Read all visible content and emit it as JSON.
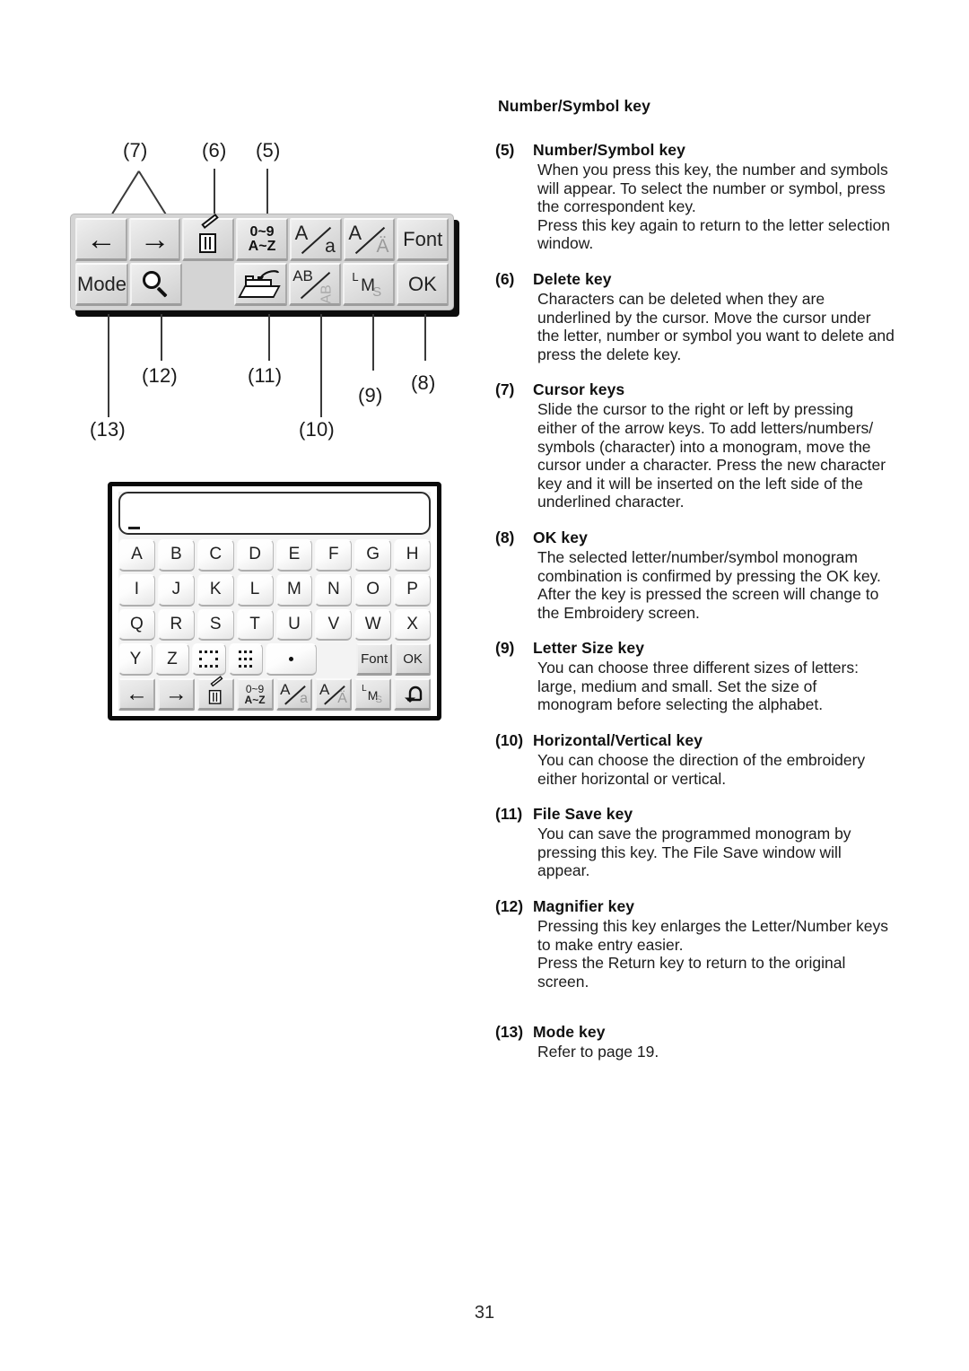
{
  "page": {
    "number": "31"
  },
  "illustration_toolbar": {
    "callouts": [
      {
        "id": "7",
        "label": "(7)"
      },
      {
        "id": "6",
        "label": "(6)"
      },
      {
        "id": "5",
        "label": "(5)"
      },
      {
        "id": "12",
        "label": "(12)"
      },
      {
        "id": "11",
        "label": "(11)"
      },
      {
        "id": "9",
        "label": "(9)"
      },
      {
        "id": "8",
        "label": "(8)"
      },
      {
        "id": "13",
        "label": "(13)"
      },
      {
        "id": "10",
        "label": "(10)"
      }
    ],
    "row1": [
      {
        "name": "cursor-left-key",
        "icon": "arrow-left-icon",
        "label": "←"
      },
      {
        "name": "cursor-right-key",
        "icon": "arrow-right-icon",
        "label": "→"
      },
      {
        "name": "delete-key",
        "icon": "trash-icon",
        "label": ""
      },
      {
        "name": "number-symbol-key",
        "icon": "number-symbol-icon",
        "label_top": "0~9",
        "label_bottom": "A~Z"
      },
      {
        "name": "case-key",
        "icon": "upper-lower-case-icon",
        "big": "A",
        "small": "a"
      },
      {
        "name": "accent-key",
        "icon": "accent-letter-icon",
        "big": "A",
        "small": "Ä"
      },
      {
        "name": "font-key",
        "icon": "font-icon",
        "label": "Font"
      }
    ],
    "row2": [
      {
        "name": "mode-key",
        "icon": "mode-icon",
        "label": "Mode"
      },
      {
        "name": "magnifier-key",
        "icon": "magnifier-icon",
        "label": ""
      },
      {
        "name": "blank-key",
        "icon": "",
        "label": ""
      },
      {
        "name": "file-save-key",
        "icon": "file-save-icon",
        "label": ""
      },
      {
        "name": "horizontal-vertical-key",
        "icon": "ab-orientation-icon",
        "big": "AB",
        "small": "AB"
      },
      {
        "name": "letter-size-key",
        "icon": "letter-size-icon",
        "l": "L",
        "m": "M",
        "s": "S"
      },
      {
        "name": "ok-key",
        "icon": "ok-icon",
        "label": "OK"
      }
    ]
  },
  "illustration_keyboard": {
    "display_value": "",
    "cursor": "_",
    "rows": [
      [
        "A",
        "B",
        "C",
        "D",
        "E",
        "F",
        "G",
        "H"
      ],
      [
        "I",
        "J",
        "K",
        "L",
        "M",
        "N",
        "O",
        "P"
      ],
      [
        "Q",
        "R",
        "S",
        "T",
        "U",
        "V",
        "W",
        "X"
      ]
    ],
    "row4": {
      "letters": [
        "Y",
        "Z"
      ],
      "space_wide": "space-wide-key",
      "space_narrow": "space-narrow-key",
      "period": ".",
      "font": "Font",
      "ok": "OK"
    },
    "row5": [
      {
        "name": "cursor-left-key",
        "icon": "arrow-left-icon",
        "label": "←"
      },
      {
        "name": "cursor-right-key",
        "icon": "arrow-right-icon",
        "label": "→"
      },
      {
        "name": "delete-key",
        "icon": "trash-icon",
        "label": ""
      },
      {
        "name": "number-symbol-key",
        "icon": "number-symbol-icon",
        "label_top": "0~9",
        "label_bottom": "A~Z"
      },
      {
        "name": "case-key",
        "icon": "upper-lower-case-icon",
        "big": "A",
        "small": "a"
      },
      {
        "name": "accent-key",
        "icon": "accent-letter-icon",
        "big": "A",
        "small": "Ä"
      },
      {
        "name": "letter-size-key",
        "icon": "letter-size-icon",
        "l": "L",
        "m": "M",
        "s": "S"
      },
      {
        "name": "return-key",
        "icon": "return-arrow-icon",
        "label": "↩"
      }
    ]
  },
  "text": {
    "heading": "Number/Symbol key",
    "entries": [
      {
        "num": "(5)",
        "title": "Number/Symbol key",
        "paragraphs": [
          "When you press this key, the number and symbols\nwill appear. To select the number or symbol, press\nthe correspondent key.",
          "Press this key again to return to the letter selection\nwindow."
        ]
      },
      {
        "num": "(6)",
        "title": "Delete key",
        "paragraphs": [
          "Characters can be deleted when they are\nunderlined by the cursor. Move the cursor under\nthe letter, number or symbol you want to delete and\npress the delete key."
        ]
      },
      {
        "num": "(7)",
        "title": " Cursor keys",
        "paragraphs": [
          "Slide the cursor to the right or left by pressing\neither of the arrow keys. To add letters/numbers/\nsymbols (character) into a monogram, move the\ncursor under a character. Press the new character\nkey and it will be inserted on the left side of the\nunderlined character."
        ]
      },
      {
        "num": "(8)",
        "title": "OK key",
        "paragraphs": [
          "The selected letter/number/symbol monogram\ncombination is confirmed by pressing the OK key.\nAfter the key is pressed the screen will change to\nthe Embroidery screen."
        ]
      },
      {
        "num": "(9)",
        "title": "Letter Size key",
        "paragraphs": [
          "You can choose three different sizes of letters:\nlarge, medium and small. Set the size of\nmonogram before selecting the alphabet."
        ]
      },
      {
        "num": "(10)",
        "title": "Horizontal/Vertical key",
        "paragraphs": [
          "You can choose the direction of the embroidery\neither horizontal or vertical."
        ]
      },
      {
        "num": "(11)",
        "title": "File Save key",
        "paragraphs": [
          "You can save the programmed monogram by\npressing this key. The File Save window will\nappear."
        ]
      },
      {
        "num": "(12)",
        "title": "Magnifier key",
        "paragraphs": [
          "Pressing this key enlarges the Letter/Number keys\nto make entry easier.",
          "Press the Return key to return to the original\nscreen."
        ]
      },
      {
        "num": "(13)",
        "title": "Mode key",
        "paragraphs": [
          " Refer to page 19."
        ]
      }
    ]
  }
}
